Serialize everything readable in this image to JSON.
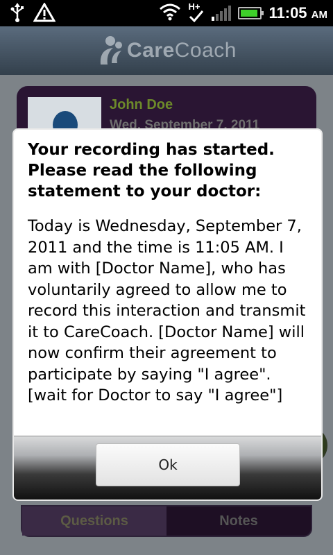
{
  "statusbar": {
    "icons_left": [
      "usb-icon",
      "warning-icon"
    ],
    "network_type": "H+",
    "time": "11:05",
    "ampm": "AM",
    "icons_right": [
      "wifi-icon",
      "hplus-icon",
      "signal-icon",
      "battery-icon"
    ],
    "battery_level": 0.8
  },
  "header": {
    "logo_text_a": "Care",
    "logo_text_b": "Coach"
  },
  "profile": {
    "name": "John Doe",
    "date": "Wed, September 7, 2011"
  },
  "tabs": [
    {
      "label": "Questions",
      "active": true
    },
    {
      "label": "Notes",
      "active": false
    }
  ],
  "dialog": {
    "title": "Your recording has started. Please read the following statement to your doctor:",
    "message": "Today is Wednesday, September 7, 2011 and the time is 11:05 AM. I am with [Doctor Name], who has voluntarily agreed to allow me to record this interaction and transmit it to CareCoach. [Doctor Name] will now confirm their agreement to participate by saying \"I agree\". [wait for Doctor to say \"I agree\"]",
    "ok_label": "Ok"
  },
  "colors": {
    "accent_green": "#6d8a2a",
    "card_purple": "#2a1533",
    "battery_green": "#3ecf2a"
  }
}
